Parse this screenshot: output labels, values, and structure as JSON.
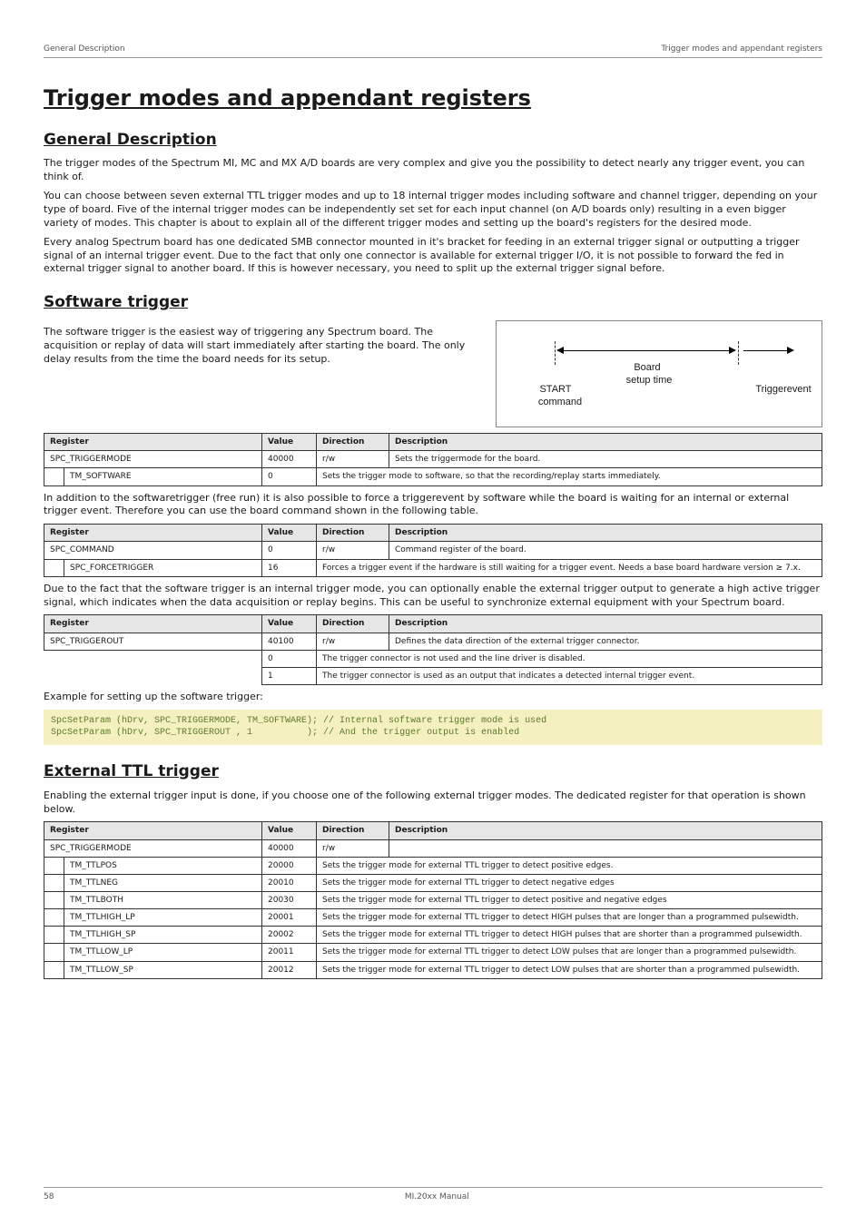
{
  "running_head": {
    "left": "General Description",
    "right": "Trigger modes and appendant registers"
  },
  "titles": {
    "h1": "Trigger modes and appendant registers",
    "general": "General Description",
    "software": "Software trigger",
    "external": "External TTL trigger"
  },
  "general_paragraphs": {
    "p1": "The trigger modes of the Spectrum MI, MC and MX A/D boards are very complex and give you the possibility to detect nearly any trigger event, you can think of.",
    "p2": "You can choose between seven external TTL trigger modes and up to 18 internal trigger modes including software and channel trigger, depending on your type of board. Five of the internal trigger modes can be independently set set for each input channel (on A/D boards only) resulting in a even bigger variety of modes. This chapter is about to explain all of the different trigger modes and setting up the board's registers for the desired mode.",
    "p3": "Every analog Spectrum board has one dedicated SMB connector mounted in it's bracket for feeding in an external trigger signal or outputting a trigger signal of an internal trigger event. Due to the fact that only one connector is available for external trigger I/O, it is not possible to forward the fed in external trigger signal to another board. If this is however necessary, you need to split up the external trigger signal before."
  },
  "software_intro": "The software trigger is the easiest way of triggering any Spectrum board. The acquisition or replay of data will start immediately after starting the board. The only delay results from the time the board needs for its setup.",
  "software_after_t1": "In addition to the softwaretrigger (free run) it is also possible to force a triggerevent by software while the board is waiting for an internal or external trigger event. Therefore you can use the board command shown in the following table.",
  "software_after_t2": "Due to the fact that the software trigger is an internal trigger mode, you can optionally enable the external trigger output to generate a high active trigger signal, which indicates when the data acquisition or replay begins. This can be useful to synchronize external equipment with your Spectrum board.",
  "example_caption": "Example for setting up the software trigger:",
  "external_intro": "Enabling the external trigger input is done, if you choose one of the following external trigger modes. The dedicated register for that operation is shown below.",
  "diagram": {
    "board": "Board",
    "setup": "setup time",
    "trigger": "Triggerevent",
    "start": "START",
    "command": "command"
  },
  "headers": {
    "register": "Register",
    "value": "Value",
    "direction": "Direction",
    "description": "Description"
  },
  "t1": {
    "row0": {
      "name": "SPC_TRIGGERMODE",
      "value": "40000",
      "dir": "r/w",
      "desc": "Sets the triggermode for the board."
    },
    "row1": {
      "name": "TM_SOFTWARE",
      "value": "0",
      "desc": "Sets the trigger mode to software, so that the recording/replay starts immediately."
    }
  },
  "t2": {
    "row0": {
      "name": "SPC_COMMAND",
      "value": "0",
      "dir": "r/w",
      "desc": "Command register of the board."
    },
    "row1": {
      "name": "SPC_FORCETRIGGER",
      "value": "16",
      "desc": "Forces a trigger event if the hardware is still waiting for a trigger event. Needs a base board hardware version ≥ 7.x."
    }
  },
  "t3": {
    "row0": {
      "name": "SPC_TRIGGEROUT",
      "value": "40100",
      "dir": "r/w",
      "desc": "Defines the data direction of the external trigger connector."
    },
    "row1": {
      "value": "0",
      "desc": "The trigger connector is not used and the line driver is disabled."
    },
    "row2": {
      "value": "1",
      "desc": "The trigger connector is used as an output that indicates a detected internal trigger event."
    }
  },
  "code": "SpcSetParam (hDrv, SPC_TRIGGERMODE, TM_SOFTWARE); // Internal software trigger mode is used\nSpcSetParam (hDrv, SPC_TRIGGEROUT , 1          ); // And the trigger output is enabled",
  "t4": {
    "row0": {
      "name": "SPC_TRIGGERMODE",
      "value": "40000",
      "dir": "r/w",
      "desc": ""
    },
    "rows": [
      {
        "name": "TM_TTLPOS",
        "value": "20000",
        "desc": "Sets the trigger mode for external TTL trigger to detect positive edges."
      },
      {
        "name": "TM_TTLNEG",
        "value": "20010",
        "desc": "Sets the trigger mode for external TTL trigger to detect negative edges"
      },
      {
        "name": "TM_TTLBOTH",
        "value": "20030",
        "desc": "Sets the trigger mode for external TTL trigger to detect positive and negative edges"
      },
      {
        "name": "TM_TTLHIGH_LP",
        "value": "20001",
        "desc": "Sets the trigger mode for external TTL trigger to detect HIGH pulses that are longer than a programmed pulsewidth."
      },
      {
        "name": "TM_TTLHIGH_SP",
        "value": "20002",
        "desc": "Sets the trigger mode for external TTL trigger to detect HIGH pulses that are shorter than a programmed pulsewidth."
      },
      {
        "name": "TM_TTLLOW_LP",
        "value": "20011",
        "desc": "Sets the trigger mode for external TTL trigger to detect LOW pulses that are longer than a programmed pulsewidth."
      },
      {
        "name": "TM_TTLLOW_SP",
        "value": "20012",
        "desc": "Sets the trigger mode for external TTL trigger to detect LOW pulses that are shorter than a programmed pulsewidth."
      }
    ]
  },
  "footer": {
    "page": "58",
    "manual": "MI.20xx Manual"
  }
}
